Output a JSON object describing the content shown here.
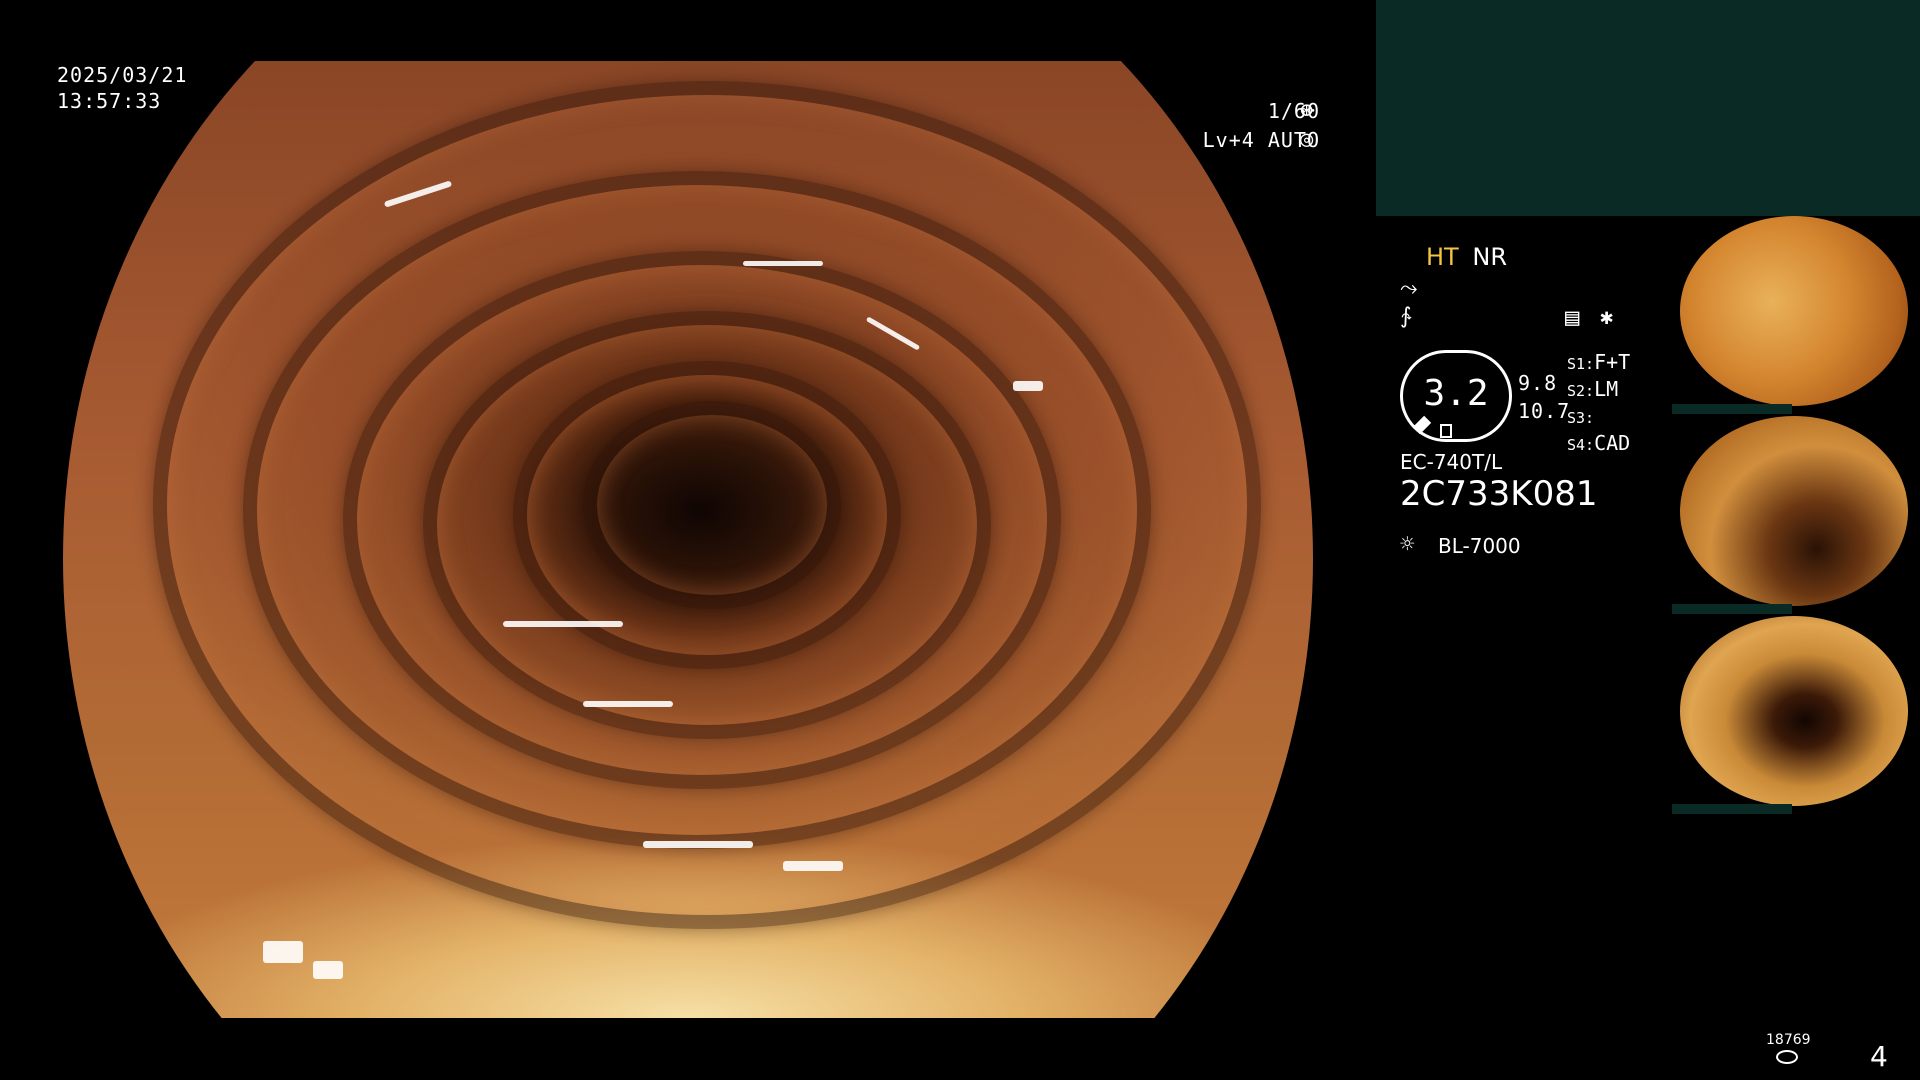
{
  "overlay": {
    "date": "2025/03/21",
    "time": "13:57:33",
    "shutter": "1/60",
    "shutter_icon": "⊛",
    "level_mode": "Lv+4 AUTO",
    "level_icon": "◎"
  },
  "processor": {
    "ht_label": "HT",
    "nr_label": "NR",
    "squiggle_icon_1": "⤳",
    "squiggle_icon_2": "∱",
    "menu_icon": "▤",
    "star": "✱",
    "scope_reading": "3.2",
    "reading_a": "9.8",
    "reading_b": "10.7",
    "s1_key": "S1:",
    "s1_val": "F+T",
    "s2_key": "S2:",
    "s2_val": "LM",
    "s3_key": "S3:",
    "s3_val": "",
    "s4_key": "S4:",
    "s4_val": "CAD",
    "scope_model": "EC-740T/L",
    "serial": "2C733K081",
    "light_source": "BL-7000"
  },
  "footer": {
    "counter": "18769",
    "page": "4"
  },
  "colors": {
    "ht_color": "#f5c542",
    "panel_dark_teal": "#0a2a26"
  }
}
